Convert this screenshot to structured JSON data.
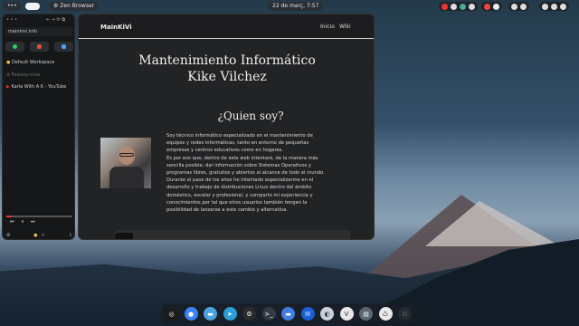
{
  "topbar": {
    "menu_dots": "•••",
    "zen_label": "Zen Browser",
    "datetime": "22 de març, 7:57"
  },
  "sidebar": {
    "url": "mainkivi.info",
    "workspace": "Default Workspace",
    "essentials": "Fesiony-nnie",
    "tab_title": "Karla With A K - YouTube",
    "media_progress": 0.08,
    "ext_colors": [
      "#25d366",
      "#e34b3c",
      "#4aa4f5"
    ]
  },
  "page": {
    "brand": "MainKiVi",
    "nav": [
      "Inicio",
      "Wiki"
    ],
    "title_line1": "Mantenimiento Informático",
    "title_line2": "Kike Vilchez",
    "section_title": "¿Quien soy?",
    "bio": [
      "Soy técnico informático especializado en el mantenimiento de",
      "equipos y redes informáticas, tanto en entorno de pequeñas",
      "empresas y centros educativos como en hogares.",
      "Es por eso que, dentro de este web intentaré, de la manera más",
      "sencilla posible, dar información sobre Sistemas Operativos y",
      "programas libres, gratuitos y abiertos al alcance de todo el mundo.",
      "Durante el paso de los años he intentado especializarme en el",
      "desarrollo y trabajo de distribuciones Linux dentro del ámbito",
      "doméstico, escolar y profesional, y comparto mi experiencia y",
      "conocimientos por tal que otros usuarios también tengan la",
      "posibilidad de lanzarse a este cambio y alternativa."
    ]
  },
  "dock": {
    "icons": [
      {
        "name": "launcher-icon",
        "color": "#1b1b1b",
        "glyph": "◎"
      },
      {
        "name": "chromium-icon",
        "color": "#3b82f6",
        "glyph": "●"
      },
      {
        "name": "files-icon",
        "color": "#4aa3df",
        "glyph": "▬"
      },
      {
        "name": "telegram-icon",
        "color": "#2a9fd8",
        "glyph": "➤"
      },
      {
        "name": "settings-icon",
        "color": "#2c2c2c",
        "glyph": "⚙"
      },
      {
        "name": "terminal-icon",
        "color": "#333a44",
        "glyph": ">_"
      },
      {
        "name": "folder-icon",
        "color": "#3d7ee0",
        "glyph": "▬"
      },
      {
        "name": "mail-icon",
        "color": "#1a5fd6",
        "glyph": "✉"
      },
      {
        "name": "appearance-icon",
        "color": "#c8d2dd",
        "glyph": "◐"
      },
      {
        "name": "vivaldi-icon",
        "color": "#e8e8e8",
        "glyph": "V"
      },
      {
        "name": "printer-icon",
        "color": "#5b6770",
        "glyph": "▤"
      },
      {
        "name": "trash-icon",
        "color": "#e8e8e8",
        "glyph": "♺"
      },
      {
        "name": "app-grid-icon",
        "color": "#262b33",
        "glyph": "∷"
      }
    ]
  }
}
